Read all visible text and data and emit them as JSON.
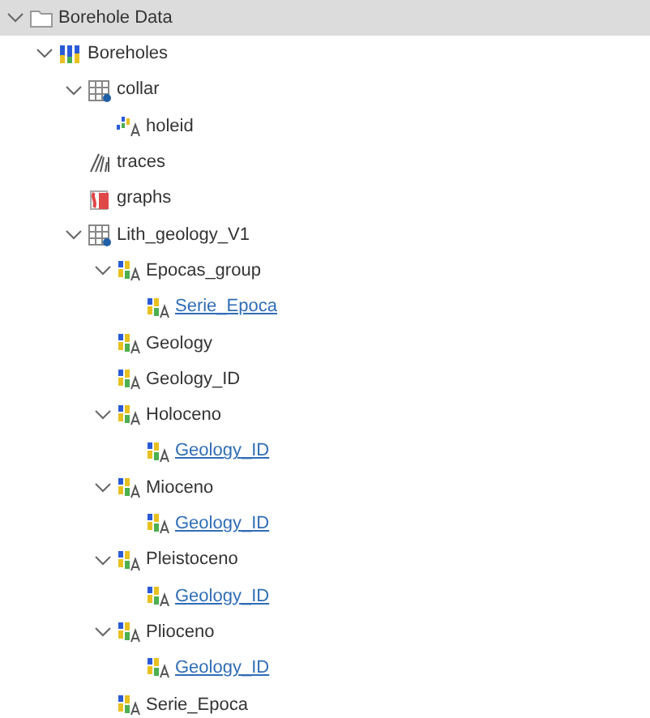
{
  "tree": [
    {
      "label": "Borehole Data",
      "kind": "folder",
      "selected": true,
      "expanded": true,
      "linked": false,
      "children": [
        {
          "label": "Boreholes",
          "kind": "boreholes",
          "selected": false,
          "expanded": true,
          "linked": false,
          "children": [
            {
              "label": "collar",
              "kind": "table",
              "selected": false,
              "expanded": true,
              "linked": false,
              "children": [
                {
                  "label": "holeid",
                  "kind": "id",
                  "selected": false,
                  "linked": false
                }
              ]
            },
            {
              "label": "traces",
              "kind": "traces",
              "selected": false,
              "linked": false
            },
            {
              "label": "graphs",
              "kind": "graphs",
              "selected": false,
              "linked": false
            },
            {
              "label": "Lith_geology_V1",
              "kind": "table",
              "selected": false,
              "expanded": true,
              "linked": false,
              "children": [
                {
                  "label": "Epocas_group",
                  "kind": "category",
                  "selected": false,
                  "expanded": true,
                  "linked": false,
                  "children": [
                    {
                      "label": "Serie_Epoca",
                      "kind": "category",
                      "selected": false,
                      "linked": true
                    }
                  ]
                },
                {
                  "label": "Geology",
                  "kind": "category",
                  "selected": false,
                  "linked": false
                },
                {
                  "label": "Geology_ID",
                  "kind": "category",
                  "selected": false,
                  "linked": false
                },
                {
                  "label": "Holoceno",
                  "kind": "category",
                  "selected": false,
                  "expanded": true,
                  "linked": false,
                  "children": [
                    {
                      "label": "Geology_ID",
                      "kind": "category",
                      "selected": false,
                      "linked": true
                    }
                  ]
                },
                {
                  "label": "Mioceno",
                  "kind": "category",
                  "selected": false,
                  "expanded": true,
                  "linked": false,
                  "children": [
                    {
                      "label": "Geology_ID",
                      "kind": "category",
                      "selected": false,
                      "linked": true
                    }
                  ]
                },
                {
                  "label": "Pleistoceno",
                  "kind": "category",
                  "selected": false,
                  "expanded": true,
                  "linked": false,
                  "children": [
                    {
                      "label": "Geology_ID",
                      "kind": "category",
                      "selected": false,
                      "linked": true
                    }
                  ]
                },
                {
                  "label": "Plioceno",
                  "kind": "category",
                  "selected": false,
                  "expanded": true,
                  "linked": false,
                  "children": [
                    {
                      "label": "Geology_ID",
                      "kind": "category",
                      "selected": false,
                      "linked": true
                    }
                  ]
                },
                {
                  "label": "Serie_Epoca",
                  "kind": "category",
                  "selected": false,
                  "linked": false
                }
              ]
            }
          ]
        }
      ]
    }
  ]
}
